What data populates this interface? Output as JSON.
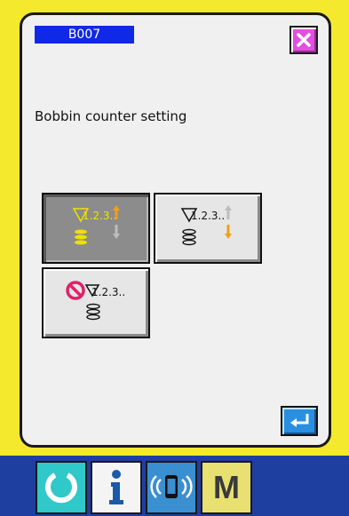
{
  "header": {
    "code": "B007",
    "close_icon": "close-x-icon"
  },
  "screen": {
    "title": "Bobbin counter setting"
  },
  "options": [
    {
      "id": "count-up",
      "icon": "bobbin-count-up-icon",
      "label": "1.2.3..",
      "selected": true
    },
    {
      "id": "count-down",
      "icon": "bobbin-count-down-icon",
      "label": "1.2.3..",
      "selected": false
    },
    {
      "id": "counter-off",
      "icon": "bobbin-counter-off-icon",
      "label": "1.2.3..",
      "selected": false
    }
  ],
  "footer": {
    "enter_icon": "enter-return-icon"
  },
  "nav": [
    {
      "id": "reset",
      "icon": "reset-circle-icon",
      "bg": "#30c8c8"
    },
    {
      "id": "information",
      "icon": "info-i-icon",
      "bg": "#f4f4f4"
    },
    {
      "id": "communication",
      "icon": "communication-icon",
      "bg": "#3a8fd0"
    },
    {
      "id": "mode",
      "icon": "mode-m-icon",
      "label": "M",
      "bg": "#e8e070"
    }
  ],
  "colors": {
    "background": "#f5e92e",
    "panel": "#f0f0f0",
    "label_blue": "#1029e6",
    "close_magenta": "#e44ee0",
    "arrow_orange": "#f0a018",
    "bottom_bar": "#1f3fa0"
  }
}
